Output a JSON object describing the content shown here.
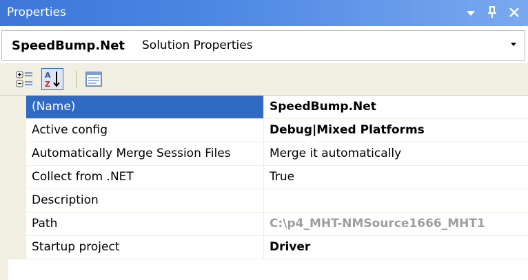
{
  "window": {
    "title": "Properties",
    "buttons": [
      "▾",
      "ᴾ",
      "✕"
    ]
  },
  "object_selector": {
    "name": "SpeedBump.Net",
    "type": "Solution Properties"
  },
  "grid": {
    "rows": [
      {
        "name": "(Name)",
        "value": "SpeedBump.Net",
        "bold": true,
        "muted": false,
        "selected": true
      },
      {
        "name": "Active config",
        "value": "Debug|Mixed Platforms",
        "bold": true,
        "muted": false,
        "selected": false
      },
      {
        "name": "Automatically Merge Session Files",
        "value": "Merge it automatically",
        "bold": false,
        "muted": false,
        "selected": false
      },
      {
        "name": "Collect from .NET",
        "value": "True",
        "bold": false,
        "muted": false,
        "selected": false
      },
      {
        "name": "Description",
        "value": "",
        "bold": false,
        "muted": false,
        "selected": false
      },
      {
        "name": "Path",
        "value": "C:\\p4_MHT-NMSource1666_MHT1",
        "bold": true,
        "muted": true,
        "selected": false
      },
      {
        "name": "Startup project",
        "value": "Driver",
        "bold": true,
        "muted": false,
        "selected": false
      }
    ]
  },
  "colors": {
    "title_bar": "#4c87e4",
    "selection": "#316ac5",
    "toolbar_bg": "#f1efe2",
    "muted_text": "#9e9e9e"
  }
}
